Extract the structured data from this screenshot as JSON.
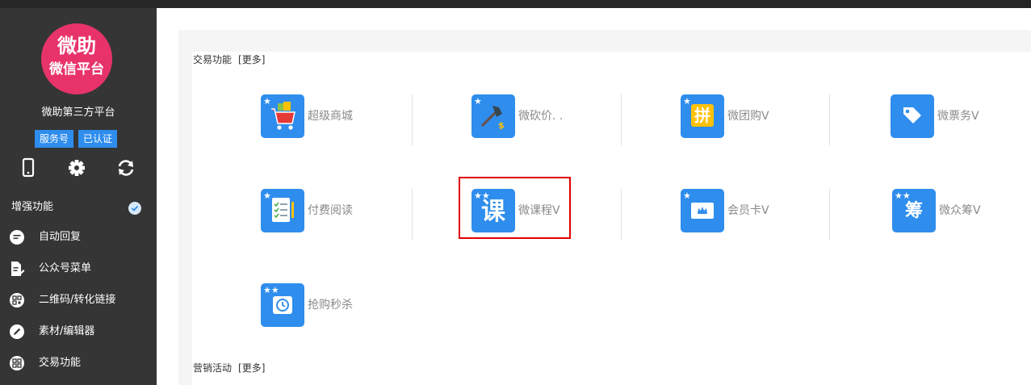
{
  "sidebar": {
    "logo": {
      "line1": "微助",
      "line2": "微信平台"
    },
    "account_name": "微助第三方平台",
    "badges": [
      "服务号",
      "已认证"
    ],
    "tools": [
      {
        "name": "phone-icon"
      },
      {
        "name": "gear-icon"
      },
      {
        "name": "refresh-icon"
      }
    ],
    "section_title": "增强功能",
    "menu": [
      {
        "label": "自动回复",
        "icon": "chat-bubble-icon"
      },
      {
        "label": "公众号菜单",
        "icon": "document-edit-icon"
      },
      {
        "label": "二维码/转化链接",
        "icon": "qrcode-icon"
      },
      {
        "label": "素材/编辑器",
        "icon": "pencil-icon"
      },
      {
        "label": "交易功能",
        "icon": "trade-icon"
      }
    ]
  },
  "sections": {
    "trade": {
      "title": "交易功能",
      "more": "[更多]"
    },
    "marketing": {
      "title": "营销活动",
      "more": "[更多]"
    }
  },
  "tiles": [
    {
      "label": "超级商城",
      "icon": "shopping-cart-icon"
    },
    {
      "label": "微砍价. .",
      "icon": "axe-icon"
    },
    {
      "label": "微团购V",
      "icon": "group-buy-icon",
      "glyph": "拼"
    },
    {
      "label": "微票务V",
      "icon": "ticket-icon"
    },
    {
      "label": "付费阅读",
      "icon": "reading-list-icon"
    },
    {
      "label": "微课程V",
      "icon": "course-icon",
      "glyph": "课"
    },
    {
      "label": "会员卡V",
      "icon": "member-card-icon"
    },
    {
      "label": "微众筹V",
      "icon": "crowdfunding-icon",
      "glyph": "筹"
    },
    {
      "label": "抢购秒杀",
      "icon": "alarm-clock-icon"
    }
  ],
  "colors": {
    "sidebar_bg": "#353535",
    "accent_blue": "#2e8ded",
    "logo_pink": "#e8336a",
    "highlight_red": "#e00000"
  }
}
